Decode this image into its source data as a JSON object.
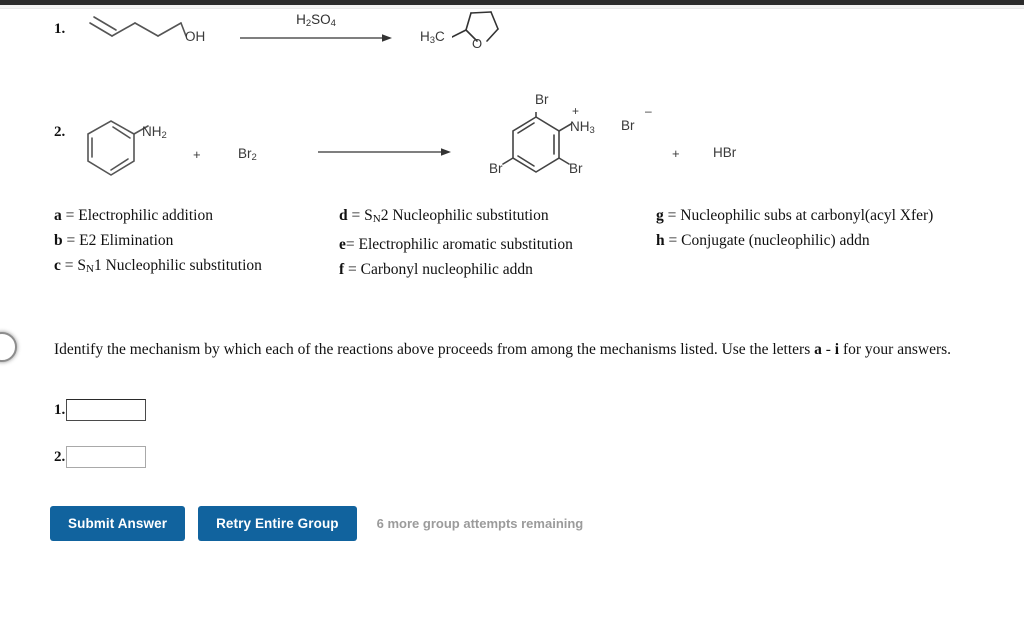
{
  "reactions": [
    {
      "number": "1.",
      "reactant_name": "pent-4-en-1-ol",
      "reactant_labels": [
        "OH"
      ],
      "condition": "H2SO4",
      "condition_html": "H<sub>2</sub>SO<sub>4</sub>",
      "product_name": "2-methyltetrahydrofuran",
      "product_labels": [
        "H3C",
        "O"
      ]
    },
    {
      "number": "2.",
      "reactant_name": "aniline",
      "reactant_labels": [
        "NH2"
      ],
      "coreactant": "Br2",
      "plus": "+",
      "condition": "",
      "product_name": "2,4,6-tribromoanilinium bromide",
      "product_labels": [
        "Br",
        "Br",
        "Br",
        "NH3",
        "Br"
      ],
      "product_charge_plus": "+",
      "product_charge_minus": "–",
      "byproduct_plus": "+",
      "byproduct": "HBr"
    }
  ],
  "legend": {
    "columns": [
      [
        {
          "letter": "a",
          "eq": " = ",
          "text": "Electrophilic addition"
        },
        {
          "letter": "b",
          "eq": " = ",
          "text": "E2 Elimination"
        },
        {
          "letter": "c",
          "eq": " = ",
          "text": "S",
          "sub": "N",
          "text2": "1 Nucleophilic substitution"
        }
      ],
      [
        {
          "letter": "d",
          "eq": " = ",
          "text": "S",
          "sub": "N",
          "text2": "2 Nucleophilic substitution"
        },
        {
          "letter": "e",
          "eq": "= ",
          "text": "Electrophilic aromatic substitution"
        },
        {
          "letter": "f",
          "eq": " = ",
          "text": "Carbonyl nucleophilic addn"
        }
      ],
      [
        {
          "letter": "g",
          "eq": " = ",
          "text": "Nucleophilic subs at carbonyl(acyl Xfer)"
        },
        {
          "letter": "h",
          "eq": " = ",
          "text": "Conjugate (nucleophilic) addn"
        }
      ]
    ]
  },
  "instructions": {
    "part1": "Identify the mechanism by which each of the reactions above proceeds from among the mechanisms listed. Use the letters ",
    "range_start": "a",
    "dash": " - ",
    "range_end": "i",
    "part2": " for your answers."
  },
  "answers": [
    {
      "label": "1.",
      "value": "",
      "placeholder": "",
      "focused": true
    },
    {
      "label": "2.",
      "value": "",
      "placeholder": "",
      "focused": false
    }
  ],
  "toolbar": {
    "submit_label": "Submit Answer",
    "retry_label": "Retry Entire Group",
    "attempts_text": "6 more group attempts remaining",
    "button_color": "#11639e",
    "attempts_color": "#9b9b9b"
  }
}
